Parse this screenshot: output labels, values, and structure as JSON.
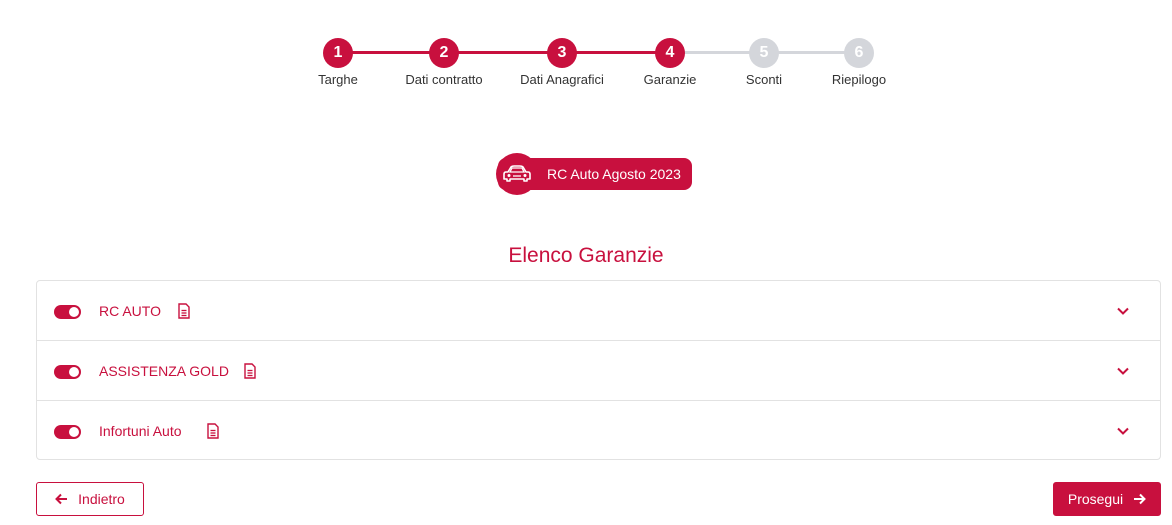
{
  "colors": {
    "accent": "#c8103e",
    "inactive": "#d4d6db",
    "border": "#e2e2e2"
  },
  "stepper": {
    "steps": [
      {
        "number": "1",
        "label": "Targhe",
        "state": "done"
      },
      {
        "number": "2",
        "label": "Dati contratto",
        "state": "done"
      },
      {
        "number": "3",
        "label": "Dati Anagrafici",
        "state": "done"
      },
      {
        "number": "4",
        "label": "Garanzie",
        "state": "current"
      },
      {
        "number": "5",
        "label": "Sconti",
        "state": "todo"
      },
      {
        "number": "6",
        "label": "Riepilogo",
        "state": "todo"
      }
    ]
  },
  "product": {
    "icon": "car-icon",
    "label": "RC Auto Agosto 2023"
  },
  "section": {
    "title": "Elenco Garanzie"
  },
  "guarantees": [
    {
      "name": "RC AUTO",
      "enabled": true,
      "icon": "document-icon"
    },
    {
      "name": "ASSISTENZA GOLD",
      "enabled": true,
      "icon": "document-icon"
    },
    {
      "name": "Infortuni Auto",
      "enabled": true,
      "icon": "document-icon"
    }
  ],
  "actions": {
    "back_label": "Indietro",
    "next_label": "Prosegui"
  }
}
